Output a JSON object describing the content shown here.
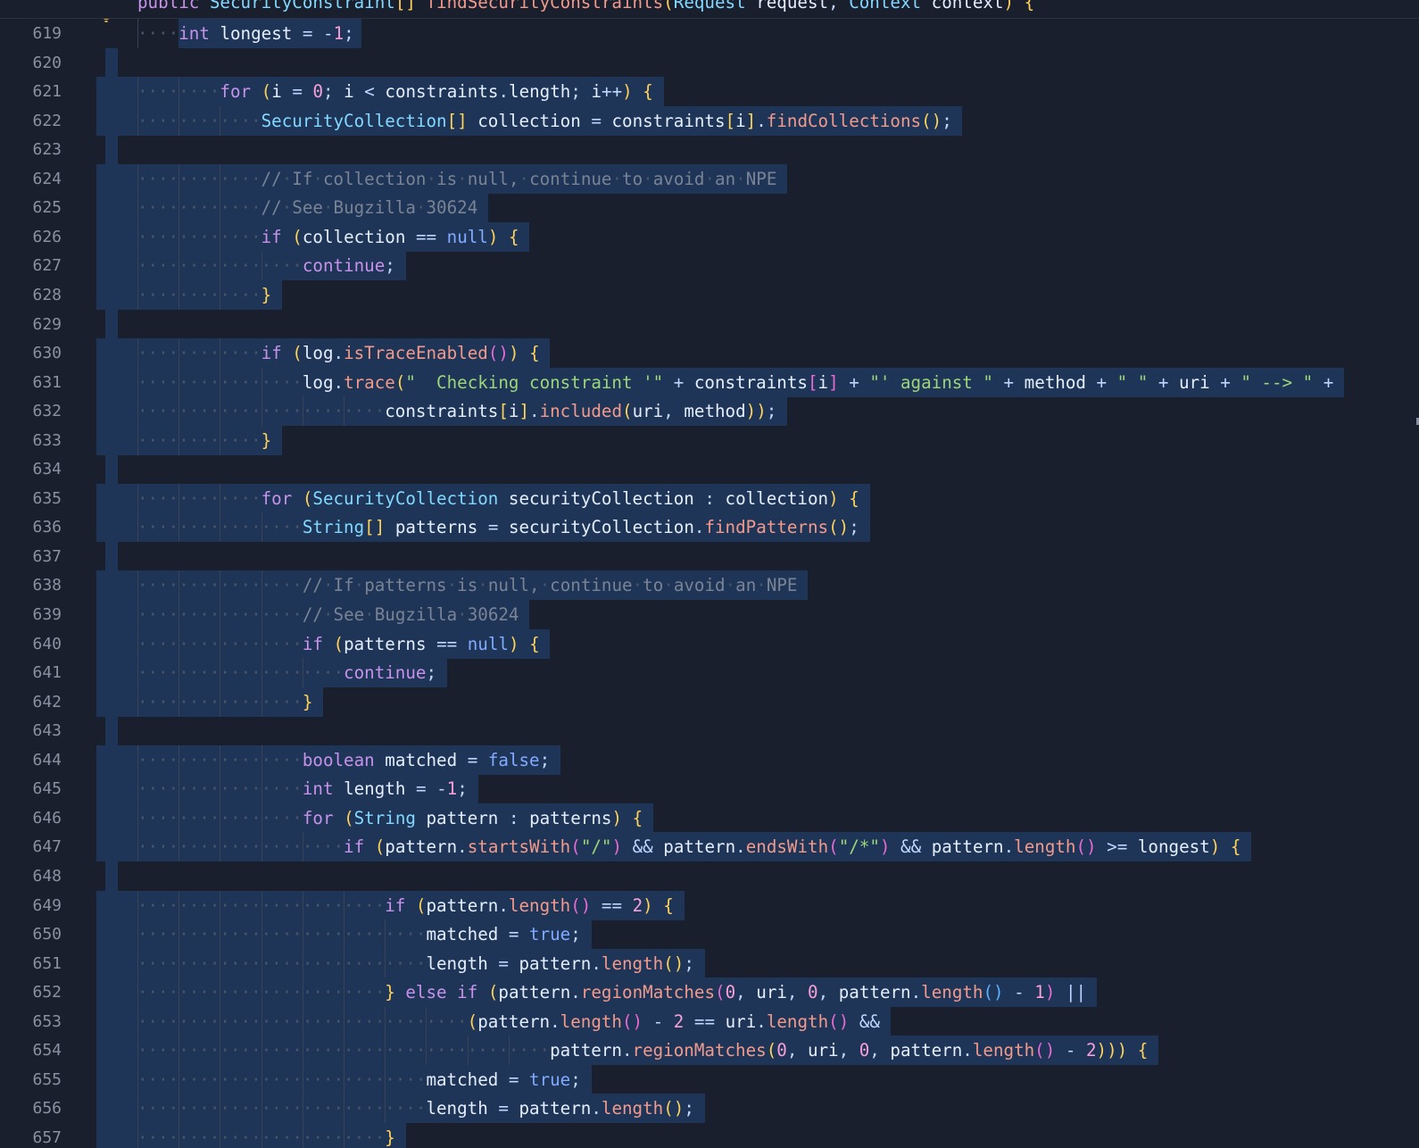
{
  "sticky_header": "public SecurityConstraint[] findSecurityConstraints(Request request, Context context) {",
  "lines": [
    {
      "n": "619",
      "text": "    int longest = -1;"
    },
    {
      "n": "620",
      "text": ""
    },
    {
      "n": "621",
      "text": "        for (i = 0; i < constraints.length; i++) {"
    },
    {
      "n": "622",
      "text": "            SecurityCollection[] collection = constraints[i].findCollections();"
    },
    {
      "n": "623",
      "text": ""
    },
    {
      "n": "624",
      "text": "            // If collection is null, continue to avoid an NPE"
    },
    {
      "n": "625",
      "text": "            // See Bugzilla 30624"
    },
    {
      "n": "626",
      "text": "            if (collection == null) {"
    },
    {
      "n": "627",
      "text": "                continue;"
    },
    {
      "n": "628",
      "text": "            }"
    },
    {
      "n": "629",
      "text": ""
    },
    {
      "n": "630",
      "text": "            if (log.isTraceEnabled()) {"
    },
    {
      "n": "631",
      "text": "                log.trace(\"  Checking constraint '\" + constraints[i] + \"' against \" + method + \" \" + uri + \" --> \" +"
    },
    {
      "n": "632",
      "text": "                        constraints[i].included(uri, method));"
    },
    {
      "n": "633",
      "text": "            }"
    },
    {
      "n": "634",
      "text": ""
    },
    {
      "n": "635",
      "text": "            for (SecurityCollection securityCollection : collection) {"
    },
    {
      "n": "636",
      "text": "                String[] patterns = securityCollection.findPatterns();"
    },
    {
      "n": "637",
      "text": ""
    },
    {
      "n": "638",
      "text": "                // If patterns is null, continue to avoid an NPE"
    },
    {
      "n": "639",
      "text": "                // See Bugzilla 30624"
    },
    {
      "n": "640",
      "text": "                if (patterns == null) {"
    },
    {
      "n": "641",
      "text": "                    continue;"
    },
    {
      "n": "642",
      "text": "                }"
    },
    {
      "n": "643",
      "text": ""
    },
    {
      "n": "644",
      "text": "                boolean matched = false;"
    },
    {
      "n": "645",
      "text": "                int length = -1;"
    },
    {
      "n": "646",
      "text": "                for (String pattern : patterns) {"
    },
    {
      "n": "647",
      "text": "                    if (pattern.startsWith(\"/\") && pattern.endsWith(\"/*\") && pattern.length() >= longest) {"
    },
    {
      "n": "648",
      "text": ""
    },
    {
      "n": "649",
      "text": "                        if (pattern.length() == 2) {"
    },
    {
      "n": "650",
      "text": "                            matched = true;"
    },
    {
      "n": "651",
      "text": "                            length = pattern.length();"
    },
    {
      "n": "652",
      "text": "                        } else if (pattern.regionMatches(0, uri, 0, pattern.length() - 1) ||"
    },
    {
      "n": "653",
      "text": "                                (pattern.length() - 2 == uri.length() &&"
    },
    {
      "n": "654",
      "text": "                                        pattern.regionMatches(0, uri, 0, pattern.length() - 2))) {"
    },
    {
      "n": "655",
      "text": "                            matched = true;"
    },
    {
      "n": "656",
      "text": "                            length = pattern.length();"
    },
    {
      "n": "657",
      "text": "                        }"
    }
  ],
  "icons": {
    "gutter": "lightbulb-icon"
  },
  "colors": {
    "background": "#1a1f2e",
    "selection": "#1e3557",
    "line_number": "#8a91a1",
    "keyword": "#c792ea",
    "function": "#f29a8c",
    "string": "#9cd67a",
    "comment": "#7a8394"
  }
}
